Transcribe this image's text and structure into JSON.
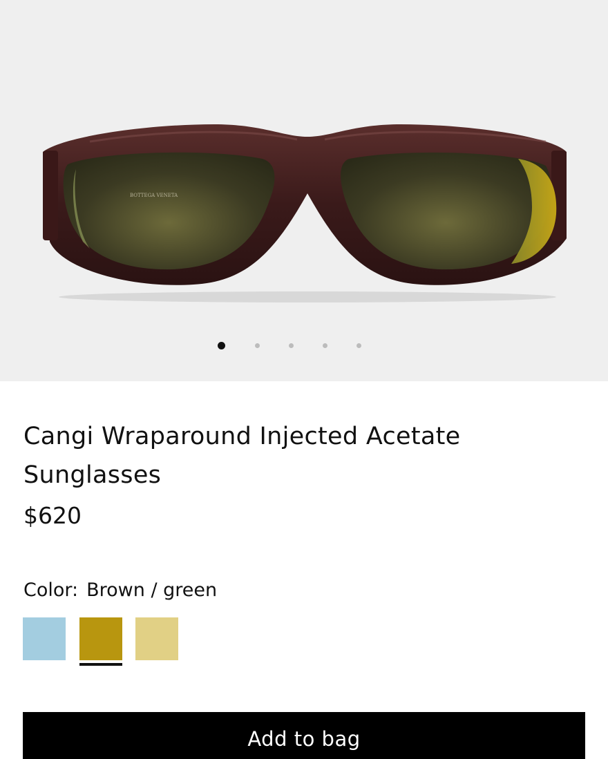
{
  "product": {
    "image_alt_icon": "sunglasses-image",
    "gallery_count": 5,
    "gallery_active_index": 0,
    "title": "Cangi Wraparound Injected Acetate Sunglasses",
    "price": "$620",
    "color_label": "Color:",
    "color_value": "Brown / green",
    "swatches": [
      {
        "name": "light blue",
        "color": "#a3cde0",
        "selected": false
      },
      {
        "name": "mustard",
        "color": "#b8960f",
        "selected": true
      },
      {
        "name": "pale yellow",
        "color": "#e1d085",
        "selected": false
      }
    ],
    "add_to_bag_label": "Add to bag"
  },
  "colors": {
    "gallery_bg": "#efefef",
    "frame": "#3a1a1a",
    "lens": "#3b3a22",
    "button_bg": "#000000"
  }
}
